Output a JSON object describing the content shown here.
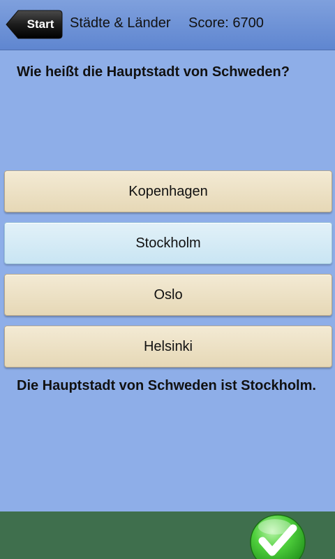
{
  "header": {
    "back_label": "Start",
    "title": "Städte & Länder",
    "score_text": "Score: 6700"
  },
  "question": {
    "text": "Wie heißt die Hauptstadt von Schweden?"
  },
  "answers": [
    {
      "label": "Kopenhagen",
      "selected": false
    },
    {
      "label": "Stockholm",
      "selected": true
    },
    {
      "label": "Oslo",
      "selected": false
    },
    {
      "label": "Helsinki",
      "selected": false
    }
  ],
  "feedback": {
    "text": "Die Hauptstadt von Schweden ist Stockholm."
  },
  "colors": {
    "background": "#8eaee8",
    "header": "#5f86d0",
    "answer": "#e6d8b6",
    "answer_selected": "#c9e5f3",
    "bottom_bar": "#3f6f4d",
    "check": "#44c33a"
  },
  "icons": {
    "confirm": "checkmark-icon"
  }
}
